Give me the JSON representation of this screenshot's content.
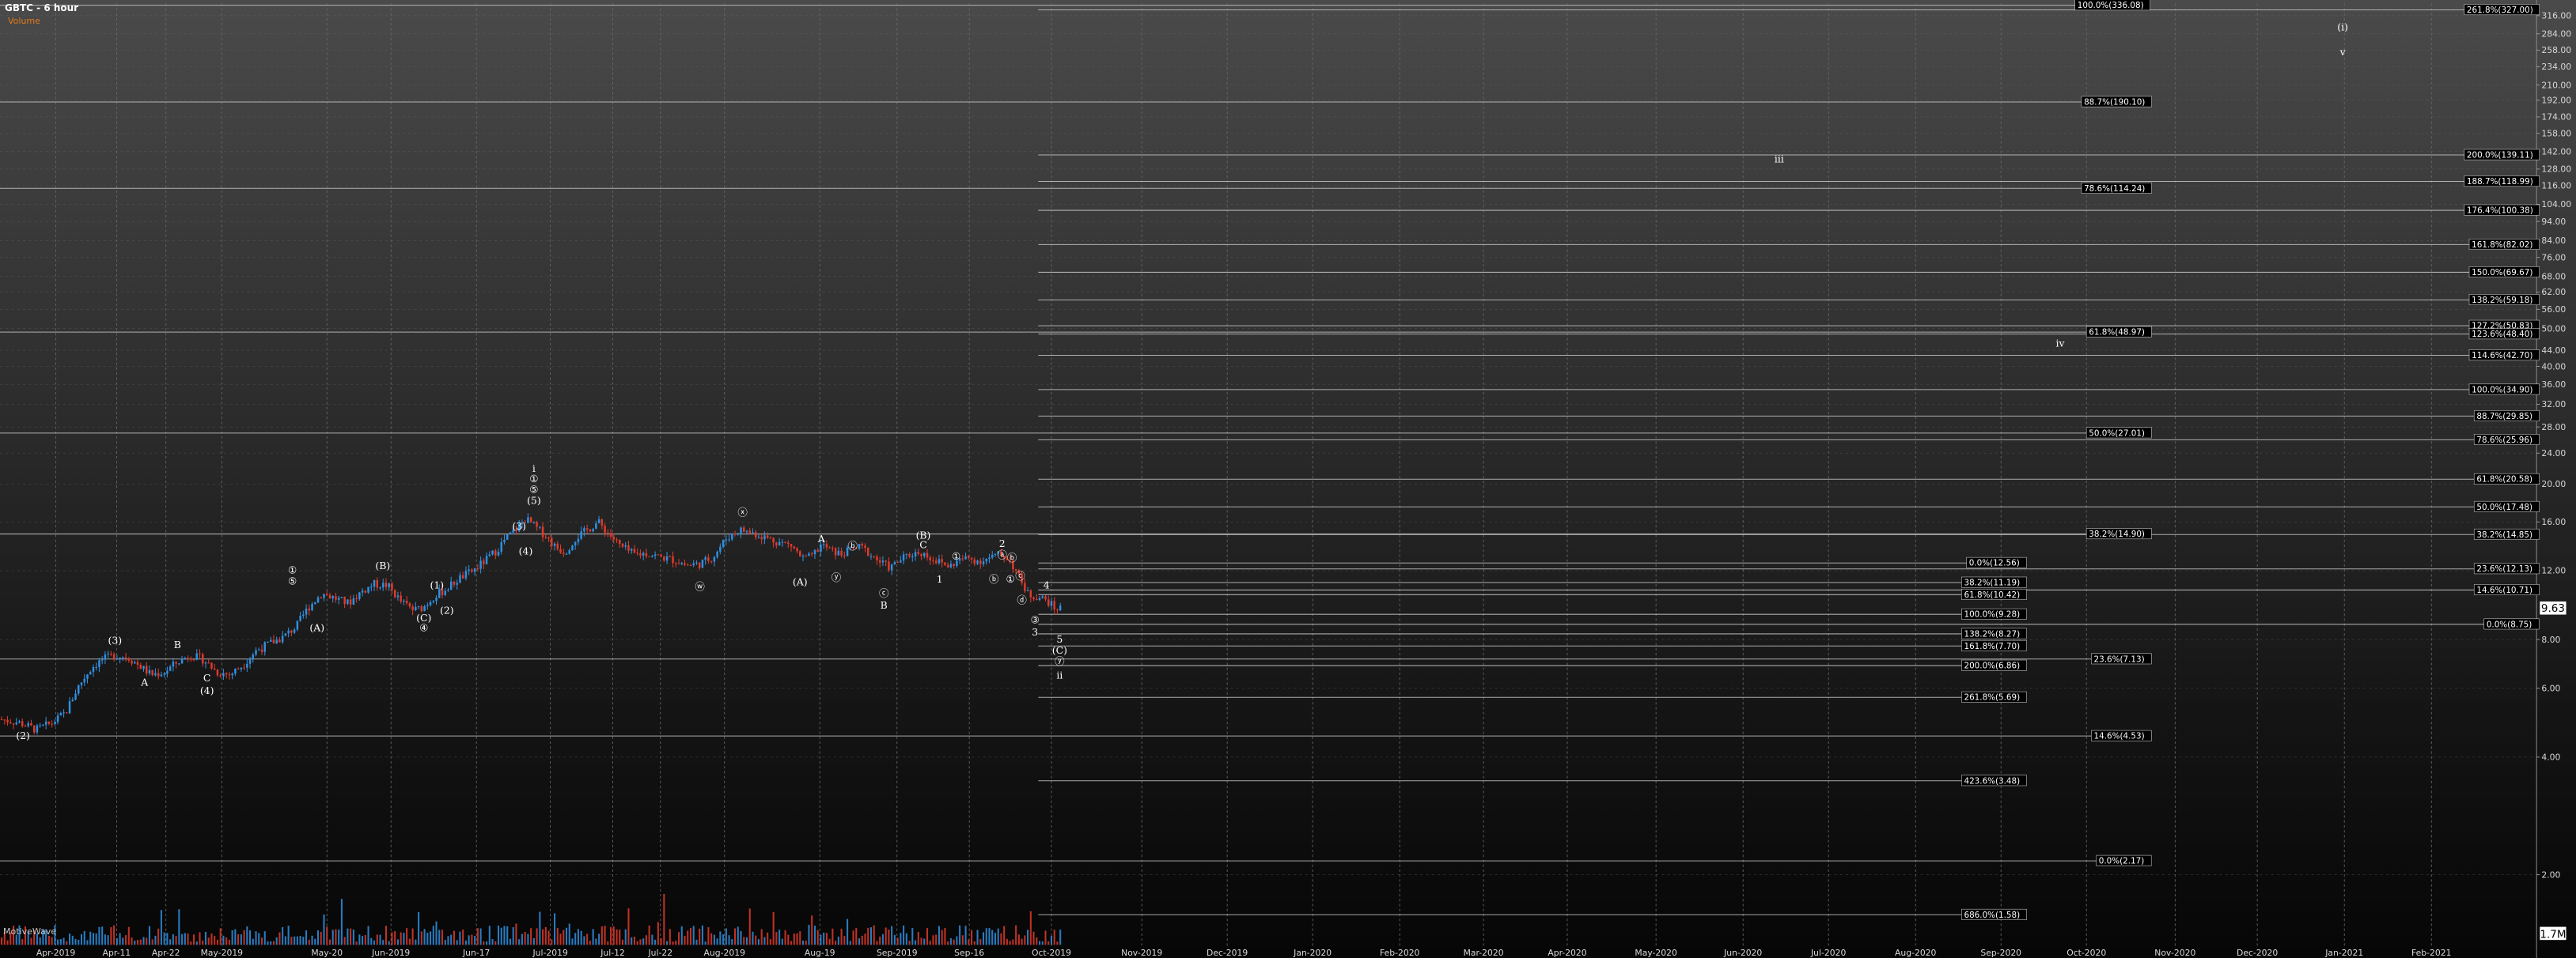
{
  "header": {
    "title": "GBTC - 6 hour",
    "subtitle": "Volume"
  },
  "watermark": "MotiveWave",
  "price_box": "9.63",
  "volume_box": "1.7M",
  "colors": {
    "up": "#2f8fe0",
    "down": "#e03a2a",
    "wave": "#ffffff",
    "fib": "#d0d0d0",
    "grid": "#6a6a6a",
    "volume_text": "#e07a1a"
  },
  "chart_data": {
    "type": "candlestick",
    "title": "GBTC - 6 hour",
    "scale": "log",
    "ylim": [
      1.5,
      340
    ],
    "y_ticks": [
      "316.00",
      "284.00",
      "258.00",
      "234.00",
      "210.00",
      "192.00",
      "174.00",
      "158.00",
      "142.00",
      "128.00",
      "116.00",
      "104.00",
      "94.00",
      "84.00",
      "76.00",
      "68.00",
      "62.00",
      "56.00",
      "50.00",
      "44.00",
      "40.00",
      "36.00",
      "32.00",
      "28.00",
      "24.00",
      "20.00",
      "16.00",
      "12.00",
      "8.00",
      "6.00",
      "4.00",
      "2.00"
    ],
    "x_ticks": [
      "Apr-2019",
      "Apr-11",
      "Apr-22",
      "May-2019",
      "May-20",
      "Jun-2019",
      "Jun-17",
      "Jul-2019",
      "Jul-12",
      "Jul-22",
      "Aug-2019",
      "Aug-19",
      "Sep-2019",
      "Sep-16",
      "Oct-2019",
      "Nov-2019",
      "Dec-2019",
      "Jan-2020",
      "Feb-2020",
      "Mar-2020",
      "Apr-2020",
      "May-2020",
      "Jun-2020",
      "Jul-2020",
      "Aug-2020",
      "Sep-2020",
      "Oct-2020",
      "Nov-2020",
      "Dec-2020",
      "Jan-2021",
      "Feb-2021"
    ],
    "price_path": [
      [
        0,
        5.0
      ],
      [
        12,
        4.9
      ],
      [
        22,
        4.7
      ],
      [
        32,
        4.9
      ],
      [
        40,
        5.2
      ],
      [
        48,
        6.1
      ],
      [
        56,
        6.8
      ],
      [
        62,
        7.1
      ],
      [
        70,
        7.3
      ],
      [
        78,
        7.2
      ],
      [
        86,
        6.8
      ],
      [
        92,
        6.5
      ],
      [
        100,
        6.6
      ],
      [
        108,
        7.0
      ],
      [
        116,
        7.3
      ],
      [
        124,
        7.1
      ],
      [
        132,
        6.6
      ],
      [
        140,
        6.5
      ],
      [
        148,
        6.9
      ],
      [
        156,
        7.5
      ],
      [
        164,
        7.8
      ],
      [
        172,
        8.1
      ],
      [
        180,
        8.6
      ],
      [
        188,
        9.7
      ],
      [
        196,
        10.5
      ],
      [
        204,
        10.2
      ],
      [
        212,
        9.9
      ],
      [
        220,
        10.6
      ],
      [
        228,
        11.1
      ],
      [
        236,
        11.0
      ],
      [
        244,
        10.0
      ],
      [
        252,
        9.5
      ],
      [
        258,
        9.7
      ],
      [
        264,
        10.3
      ],
      [
        272,
        10.8
      ],
      [
        280,
        11.5
      ],
      [
        288,
        12.0
      ],
      [
        296,
        12.8
      ],
      [
        302,
        13.5
      ],
      [
        308,
        14.5
      ],
      [
        314,
        15.3
      ],
      [
        320,
        16.3
      ],
      [
        326,
        15.5
      ],
      [
        332,
        14.8
      ],
      [
        338,
        13.8
      ],
      [
        344,
        13.4
      ],
      [
        350,
        14.5
      ],
      [
        356,
        15.1
      ],
      [
        364,
        16.0
      ],
      [
        370,
        15.0
      ],
      [
        378,
        13.8
      ],
      [
        386,
        13.2
      ],
      [
        394,
        13.3
      ],
      [
        402,
        13.0
      ],
      [
        410,
        12.8
      ],
      [
        418,
        12.4
      ],
      [
        426,
        12.5
      ],
      [
        434,
        13.0
      ],
      [
        442,
        14.5
      ],
      [
        450,
        15.3
      ],
      [
        458,
        15.0
      ],
      [
        466,
        14.6
      ],
      [
        474,
        14.2
      ],
      [
        482,
        13.9
      ],
      [
        488,
        12.9
      ],
      [
        494,
        13.0
      ],
      [
        500,
        14.0
      ],
      [
        506,
        13.5
      ],
      [
        512,
        13.2
      ],
      [
        518,
        13.6
      ],
      [
        524,
        13.8
      ],
      [
        530,
        13.2
      ],
      [
        536,
        12.6
      ],
      [
        542,
        12.2
      ],
      [
        548,
        12.8
      ],
      [
        554,
        13.2
      ],
      [
        560,
        13.4
      ],
      [
        566,
        13.0
      ],
      [
        572,
        12.6
      ],
      [
        578,
        12.3
      ],
      [
        584,
        12.8
      ],
      [
        590,
        12.9
      ],
      [
        596,
        12.7
      ],
      [
        602,
        12.9
      ],
      [
        608,
        13.2
      ],
      [
        614,
        12.9
      ],
      [
        620,
        11.6
      ],
      [
        626,
        10.4
      ],
      [
        632,
        10.3
      ],
      [
        638,
        10.0
      ],
      [
        642,
        9.6
      ],
      [
        646,
        9.63
      ]
    ],
    "wave_labels": [
      {
        "t": "(2)",
        "x": 14,
        "p": 4.45
      },
      {
        "t": "(3)",
        "x": 70,
        "p": 7.8
      },
      {
        "t": "A",
        "x": 88,
        "p": 6.1
      },
      {
        "t": "B",
        "x": 108,
        "p": 7.6
      },
      {
        "t": "C",
        "x": 126,
        "p": 6.25
      },
      {
        "t": "(4)",
        "x": 126,
        "p": 5.8
      },
      {
        "t": "①",
        "x": 178,
        "p": 11.8
      },
      {
        "t": "⑤",
        "x": 178,
        "p": 11.05
      },
      {
        "t": "(A)",
        "x": 193,
        "p": 8.4
      },
      {
        "t": "(B)",
        "x": 233,
        "p": 12.1
      },
      {
        "t": "(C)",
        "x": 258,
        "p": 8.9
      },
      {
        "t": "④",
        "x": 258,
        "p": 8.4
      },
      {
        "t": "(1)",
        "x": 266,
        "p": 10.8
      },
      {
        "t": "(2)",
        "x": 272,
        "p": 9.3
      },
      {
        "t": "(3)",
        "x": 316,
        "p": 15.3
      },
      {
        "t": "(4)",
        "x": 320,
        "p": 13.2
      },
      {
        "t": "ⅰ",
        "x": 325,
        "p": 21.5
      },
      {
        "t": "①",
        "x": 325,
        "p": 20.2
      },
      {
        "t": "⑤",
        "x": 325,
        "p": 19.0
      },
      {
        "t": "(5)",
        "x": 325,
        "p": 17.8
      },
      {
        "t": "ⓦ",
        "x": 426,
        "p": 10.7
      },
      {
        "t": "ⓧ",
        "x": 452,
        "p": 16.6
      },
      {
        "t": "(A)",
        "x": 487,
        "p": 11.0
      },
      {
        "t": "A",
        "x": 500,
        "p": 14.2
      },
      {
        "t": "ⓨ",
        "x": 509,
        "p": 11.3
      },
      {
        "t": "ⓑ",
        "x": 519,
        "p": 13.6
      },
      {
        "t": "ⓒ",
        "x": 538,
        "p": 10.3
      },
      {
        "t": "B",
        "x": 538,
        "p": 9.6
      },
      {
        "t": "(B)",
        "x": 562,
        "p": 14.5
      },
      {
        "t": "C",
        "x": 562,
        "p": 13.7
      },
      {
        "t": "①",
        "x": 582,
        "p": 12.8
      },
      {
        "t": "1",
        "x": 572,
        "p": 11.2
      },
      {
        "t": "2",
        "x": 610,
        "p": 13.8
      },
      {
        "t": "ⓐ",
        "x": 610,
        "p": 12.9
      },
      {
        "t": "ⓑ",
        "x": 616,
        "p": 12.7
      },
      {
        "t": "ⓑ",
        "x": 605,
        "p": 11.2
      },
      {
        "t": "①",
        "x": 615,
        "p": 11.2
      },
      {
        "t": "ⓒ",
        "x": 621,
        "p": 11.4
      },
      {
        "t": "ⓓ",
        "x": 622,
        "p": 9.9
      },
      {
        "t": "4",
        "x": 637,
        "p": 10.8
      },
      {
        "t": "③",
        "x": 630,
        "p": 8.8
      },
      {
        "t": "3",
        "x": 630,
        "p": 8.2
      },
      {
        "t": "5",
        "x": 645,
        "p": 7.85
      },
      {
        "t": "(C)",
        "x": 645,
        "p": 7.35
      },
      {
        "t": "ⓨ",
        "x": 645,
        "p": 6.9
      },
      {
        "t": "ⅱ",
        "x": 645,
        "p": 6.35
      },
      {
        "t": "ⅲ",
        "x": 1083,
        "p": 133
      },
      {
        "t": "ⅳ",
        "x": 1254,
        "p": 45
      },
      {
        "t": "(i)",
        "x": 1426,
        "p": 290
      },
      {
        "t": "ⅴ",
        "x": 1426,
        "p": 250
      }
    ],
    "fib_levels": [
      {
        "label": "100.0%(336.08)",
        "value": 336.08,
        "x1": 0,
        "x2": 1306,
        "lx": 1263
      },
      {
        "label": "88.7%(190.10)",
        "value": 190.1,
        "x1": 0,
        "x2": 1306,
        "lx": 1267
      },
      {
        "label": "78.6%(114.24)",
        "value": 114.24,
        "x1": 0,
        "x2": 1306,
        "lx": 1267
      },
      {
        "label": "61.8%(48.97)",
        "value": 48.97,
        "x1": 0,
        "x2": 1306,
        "lx": 1270
      },
      {
        "label": "50.0%(27.01)",
        "value": 27.01,
        "x1": 0,
        "x2": 1306,
        "lx": 1270
      },
      {
        "label": "38.2%(14.90)",
        "value": 14.9,
        "x1": 0,
        "x2": 1306,
        "lx": 1270
      },
      {
        "label": "23.6%(7.13)",
        "value": 7.13,
        "x1": 0,
        "x2": 1306,
        "lx": 1273
      },
      {
        "label": "14.6%(4.53)",
        "value": 4.53,
        "x1": 0,
        "x2": 1306,
        "lx": 1273
      },
      {
        "label": "0.0%(2.17)",
        "value": 2.17,
        "x1": 0,
        "x2": 1306,
        "lx": 1276
      },
      {
        "label": "0.0%(12.56)",
        "value": 12.56,
        "x1": 632,
        "x2": 1232,
        "lx": 1197
      },
      {
        "label": "38.2%(11.19)",
        "value": 11.19,
        "x1": 632,
        "x2": 1232,
        "lx": 1194
      },
      {
        "label": "61.8%(10.42)",
        "value": 10.42,
        "x1": 632,
        "x2": 1232,
        "lx": 1194
      },
      {
        "label": "100.0%(9.28)",
        "value": 9.28,
        "x1": 632,
        "x2": 1232,
        "lx": 1194
      },
      {
        "label": "138.2%(8.27)",
        "value": 8.27,
        "x1": 632,
        "x2": 1232,
        "lx": 1194
      },
      {
        "label": "161.8%(7.70)",
        "value": 7.7,
        "x1": 632,
        "x2": 1232,
        "lx": 1194
      },
      {
        "label": "200.0%(6.86)",
        "value": 6.86,
        "x1": 632,
        "x2": 1232,
        "lx": 1194
      },
      {
        "label": "261.8%(5.69)",
        "value": 5.69,
        "x1": 632,
        "x2": 1232,
        "lx": 1194
      },
      {
        "label": "423.6%(3.48)",
        "value": 3.48,
        "x1": 632,
        "x2": 1232,
        "lx": 1194
      },
      {
        "label": "686.0%(1.58)",
        "value": 1.58,
        "x1": 632,
        "x2": 1232,
        "lx": 1194
      },
      {
        "label": "261.8%(327.00)",
        "value": 327.0,
        "x1": 632,
        "x2": 1544,
        "lx": 1500
      },
      {
        "label": "200.0%(139.11)",
        "value": 139.11,
        "x1": 632,
        "x2": 1544,
        "lx": 1500
      },
      {
        "label": "188.7%(118.99)",
        "value": 118.99,
        "x1": 632,
        "x2": 1544,
        "lx": 1500
      },
      {
        "label": "176.4%(100.38)",
        "value": 100.38,
        "x1": 632,
        "x2": 1544,
        "lx": 1500
      },
      {
        "label": "161.8%(82.02)",
        "value": 82.02,
        "x1": 632,
        "x2": 1544,
        "lx": 1503
      },
      {
        "label": "150.0%(69.67)",
        "value": 69.67,
        "x1": 632,
        "x2": 1544,
        "lx": 1503
      },
      {
        "label": "138.2%(59.18)",
        "value": 59.18,
        "x1": 632,
        "x2": 1544,
        "lx": 1503
      },
      {
        "label": "127.2%(50.83)",
        "value": 50.83,
        "x1": 632,
        "x2": 1544,
        "lx": 1503
      },
      {
        "label": "123.6%(48.40)",
        "value": 48.4,
        "x1": 632,
        "x2": 1544,
        "lx": 1503
      },
      {
        "label": "114.6%(42.70)",
        "value": 42.7,
        "x1": 632,
        "x2": 1544,
        "lx": 1503
      },
      {
        "label": "100.0%(34.90)",
        "value": 34.9,
        "x1": 632,
        "x2": 1544,
        "lx": 1503
      },
      {
        "label": "88.7%(29.85)",
        "value": 29.85,
        "x1": 632,
        "x2": 1544,
        "lx": 1506
      },
      {
        "label": "78.6%(25.96)",
        "value": 25.96,
        "x1": 632,
        "x2": 1544,
        "lx": 1506
      },
      {
        "label": "61.8%(20.58)",
        "value": 20.58,
        "x1": 632,
        "x2": 1544,
        "lx": 1506
      },
      {
        "label": "50.0%(17.48)",
        "value": 17.48,
        "x1": 632,
        "x2": 1544,
        "lx": 1506
      },
      {
        "label": "38.2%(14.85)",
        "value": 14.85,
        "x1": 632,
        "x2": 1544,
        "lx": 1506
      },
      {
        "label": "23.6%(12.13)",
        "value": 12.13,
        "x1": 632,
        "x2": 1544,
        "lx": 1506
      },
      {
        "label": "14.6%(10.71)",
        "value": 10.71,
        "x1": 632,
        "x2": 1544,
        "lx": 1506
      },
      {
        "label": "0.0%(8.75)",
        "value": 8.75,
        "x1": 632,
        "x2": 1544,
        "lx": 1512
      }
    ]
  }
}
